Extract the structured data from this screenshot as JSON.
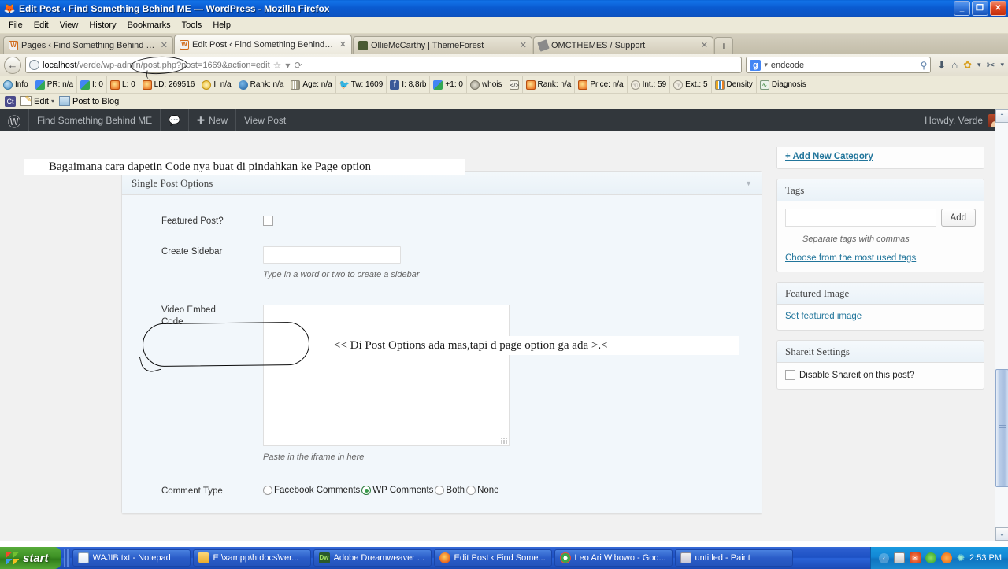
{
  "window": {
    "title": "Edit Post ‹ Find Something Behind ME — WordPress - Mozilla Firefox",
    "minimize": "_",
    "restore": "❐",
    "close": "✕"
  },
  "menu": [
    "File",
    "Edit",
    "View",
    "History",
    "Bookmarks",
    "Tools",
    "Help"
  ],
  "tabs": [
    {
      "label": "Pages ‹ Find Something Behind ME — Wo...",
      "icon": "wordpress-favicon",
      "active": false,
      "close": "✕"
    },
    {
      "label": "Edit Post ‹ Find Something Behind ME — ...",
      "icon": "wordpress-favicon",
      "active": true,
      "close": "✕"
    },
    {
      "label": "OllieMcCarthy | ThemeForest",
      "icon": "themeforest-favicon",
      "active": false,
      "close": "✕"
    },
    {
      "label": "OMCTHEMES / Support",
      "icon": "omcthemes-favicon",
      "active": false,
      "close": "✕"
    }
  ],
  "new_tab_label": "+",
  "nav": {
    "back_icon": "←",
    "url_host": "localhost",
    "url_rest": "/verde/wp-admin/post.php?post=1669&action=edit",
    "bookmark_icon": "☆",
    "dropdown_icon": "▾",
    "reload_icon": "⟳",
    "download_icon": "⬇",
    "home_icon": "⌂",
    "addon_icon": "✿",
    "addon_caret": "▾",
    "tool_icon": "✂",
    "tool_caret": "▾"
  },
  "search": {
    "engine": "g",
    "engine_caret": "▾",
    "value": "endcode",
    "magnifier": "⚲"
  },
  "seo_toolbar": [
    {
      "icon": "info-icon",
      "style": "sq-blue",
      "label": "Info"
    },
    {
      "icon": "google-pagerank-icon",
      "style": "sq-g",
      "label": "PR: n/a"
    },
    {
      "icon": "google-index-icon",
      "style": "sq-g",
      "label": "I: 0"
    },
    {
      "icon": "links-icon",
      "style": "sq-orange",
      "label": "L: 0"
    },
    {
      "icon": "linkdomain-icon",
      "style": "sq-orange",
      "label": "LD: 269516"
    },
    {
      "icon": "yahoo-index-icon",
      "style": "sq-yellow",
      "label": "I: n/a"
    },
    {
      "icon": "alexa-rank-icon",
      "style": "sq-ablue",
      "label": "Rank: n/a"
    },
    {
      "icon": "age-icon",
      "style": "sq-bars",
      "label": "Age: n/a"
    },
    {
      "icon": "twitter-icon",
      "style": "sq-tw",
      "label": "Tw: 1609",
      "glyph": "🐦"
    },
    {
      "icon": "facebook-icon",
      "style": "sq-fb",
      "label": "I: 8,8rb",
      "glyph": "f"
    },
    {
      "icon": "google-plus-icon",
      "style": "sq-g",
      "label": "+1: 0"
    },
    {
      "icon": "whois-icon",
      "style": "sq-whois",
      "label": "whois"
    },
    {
      "icon": "source-code-icon",
      "style": "sq-code",
      "label": "",
      "glyph": "</>"
    },
    {
      "icon": "rank-icon",
      "style": "sq-orange",
      "label": "Rank: n/a"
    },
    {
      "icon": "price-icon",
      "style": "sq-orange",
      "label": "Price: n/a"
    },
    {
      "icon": "internal-links-icon",
      "style": "sq-hand",
      "label": "Int.: 59",
      "glyph": "☜"
    },
    {
      "icon": "external-links-icon",
      "style": "sq-hand",
      "label": "Ext.: 5",
      "glyph": "☞"
    },
    {
      "icon": "density-icon",
      "style": "sq-density",
      "label": "Density"
    },
    {
      "icon": "diagnosis-icon",
      "style": "sq-diag",
      "label": "Diagnosis",
      "glyph": "∿"
    }
  ],
  "bookmarks": {
    "ct_label": "Ct",
    "edit_label": "Edit",
    "edit_caret": "▾",
    "post_to_blog_label": "Post to Blog"
  },
  "wp_adminbar": {
    "logo": "Ⓦ",
    "site_name": "Find Something Behind ME",
    "comments_icon": "💬",
    "new_label": "New",
    "new_icon": "✚",
    "view_post_label": "View Post",
    "howdy": "Howdy, Verde"
  },
  "main_panel": {
    "title": "Single Post Options",
    "toggle_icon": "▼",
    "fields": {
      "featured_post_label": "Featured Post?",
      "featured_post_checked": false,
      "create_sidebar_label": "Create Sidebar",
      "create_sidebar_value": "",
      "create_sidebar_hint": "Type in a word or two to create a sidebar",
      "video_embed_label_line1": "Video Embed",
      "video_embed_label_line2": "Code",
      "video_embed_value": "",
      "video_embed_hint": "Paste in the iframe in here",
      "comment_type_label": "Comment Type",
      "comment_type_options": [
        {
          "label": "Facebook Comments",
          "selected": false
        },
        {
          "label": "WP Comments",
          "selected": true
        },
        {
          "label": "Both",
          "selected": false
        },
        {
          "label": "None",
          "selected": false
        }
      ]
    }
  },
  "annotation": {
    "line1": "<< Di Post Options ada mas,tapi d page option ga ada >.<",
    "line2": "Bagaimana cara dapetin  Code nya buat di pindahkan ke Page option"
  },
  "sidebar": {
    "add_new_category": "+ Add New Category",
    "tags": {
      "title": "Tags",
      "input_value": "",
      "add_button": "Add",
      "hint": "Separate tags with commas",
      "most_used_link": "Choose from the most used tags"
    },
    "featured_image": {
      "title": "Featured Image",
      "link": "Set featured image"
    },
    "shareit": {
      "title": "Shareit Settings",
      "checkbox_label": "Disable Shareit on this post?",
      "checked": false
    }
  },
  "scrollbar": {
    "up": "⌃",
    "down": "⌄"
  },
  "taskbar": {
    "start_label": "start",
    "items": [
      {
        "label": "WAJIB.txt - Notepad",
        "icon": "notepad-icon"
      },
      {
        "label": "E:\\xampp\\htdocs\\ver...",
        "icon": "folder-icon"
      },
      {
        "label": "Adobe Dreamweaver ...",
        "icon": "dreamweaver-icon"
      },
      {
        "label": "Edit Post ‹ Find Some...",
        "icon": "firefox-icon"
      },
      {
        "label": "Leo Ari Wibowo - Goo...",
        "icon": "chrome-icon"
      },
      {
        "label": "untitled - Paint",
        "icon": "paint-icon"
      }
    ],
    "tray": {
      "expand_icon": "‹",
      "icons": [
        "security-icon",
        "app-red-icon",
        "update-icon",
        "media-icon",
        "antivirus-icon"
      ],
      "clock": "2:53 PM"
    }
  }
}
